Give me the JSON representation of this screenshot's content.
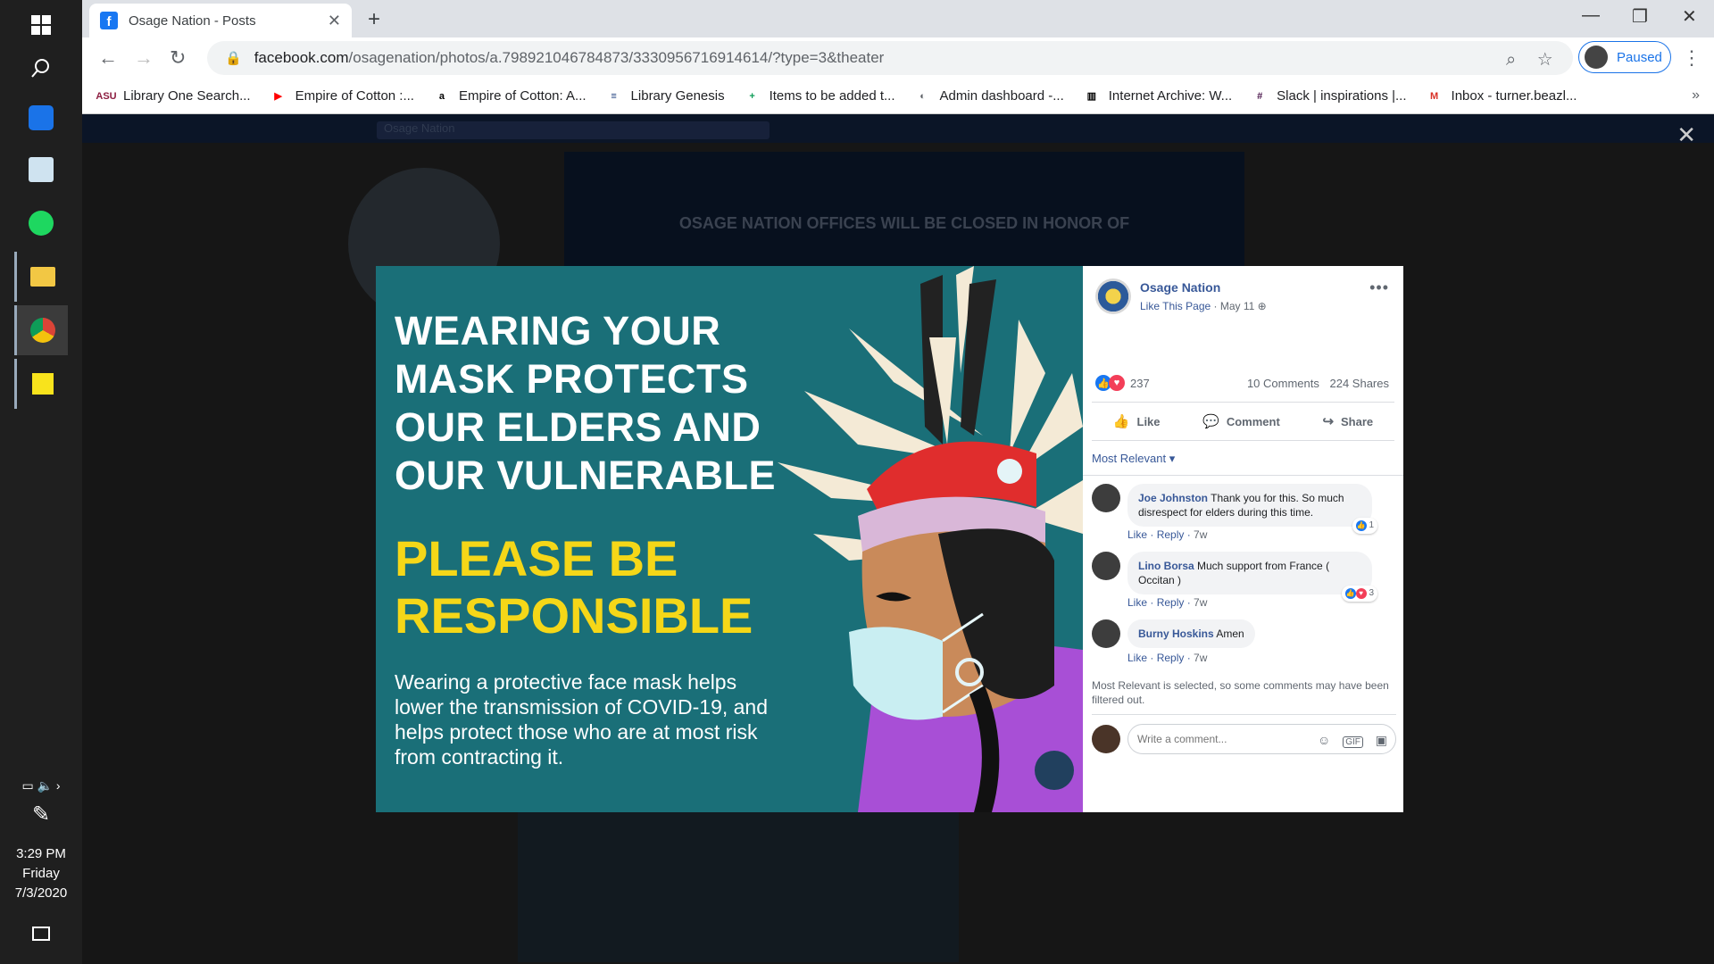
{
  "taskbar": {
    "time": "3:29 PM",
    "day": "Friday",
    "date": "7/3/2020"
  },
  "browser": {
    "tab_title": "Osage Nation - Posts",
    "url_host": "facebook.com",
    "url_path": "/osagenation/photos/a.798921046784873/3330956716914614/?type=3&theater",
    "profile_label": "Paused",
    "bookmarks": [
      {
        "label": "Library One Search...",
        "icon": "asu-icon",
        "color": "#8c1d40"
      },
      {
        "label": "Empire of Cotton :...",
        "icon": "youtube-icon",
        "color": "#ff0000"
      },
      {
        "label": "Empire of Cotton: A...",
        "icon": "amazon-icon",
        "color": "#000000"
      },
      {
        "label": "Library Genesis",
        "icon": "libgen-icon",
        "color": "#1a3d7c"
      },
      {
        "label": "Items to be added t...",
        "icon": "sheets-icon",
        "color": "#0f9d58"
      },
      {
        "label": "Admin dashboard -...",
        "icon": "globe-icon",
        "color": "#5f6368"
      },
      {
        "label": "Internet Archive: W...",
        "icon": "archive-icon",
        "color": "#000000"
      },
      {
        "label": "Slack | inspirations |...",
        "icon": "slack-icon",
        "color": "#4a154b"
      },
      {
        "label": "Inbox - turner.beazl...",
        "icon": "gmail-icon",
        "color": "#d93025"
      }
    ]
  },
  "background_page": {
    "search_placeholder": "Osage Nation",
    "cover_text": "OSAGE NATION OFFICES WILL BE CLOSED IN HONOR OF"
  },
  "photo": {
    "headline": "WEARING YOUR MASK PROTECTS OUR ELDERS AND OUR VULNERABLE",
    "callout": "PLEASE BE RESPONSIBLE",
    "body": "Wearing a protective face mask helps lower the transmission of COVID-19, and helps protect those who are at most risk from contracting it."
  },
  "post": {
    "page_name": "Osage Nation",
    "like_page": "Like This Page",
    "date": "May 11",
    "reaction_count": "237",
    "comments_count": "10 Comments",
    "shares_count": "224 Shares",
    "actions": {
      "like": "Like",
      "comment": "Comment",
      "share": "Share"
    },
    "sort_label": "Most Relevant ▾",
    "filtered_note": "Most Relevant is selected, so some comments may have been filtered out.",
    "comment_placeholder": "Write a comment...",
    "comments": [
      {
        "name": "Joe Johnston",
        "text": "Thank you for this. So much disrespect for elders during this time.",
        "like": "Like",
        "reply": "Reply",
        "time": "7w",
        "reactions": "1"
      },
      {
        "name": "Lino Borsa",
        "text": "Much support from France ( Occitan )",
        "like": "Like",
        "reply": "Reply",
        "time": "7w",
        "reactions": "3"
      },
      {
        "name": "Burny Hoskins",
        "text": "Amen",
        "like": "Like",
        "reply": "Reply",
        "time": "7w",
        "reactions": ""
      }
    ]
  },
  "colors": {
    "photo_bg": "#1a6f78",
    "callout": "#f5d718",
    "fb_link": "#385898"
  }
}
